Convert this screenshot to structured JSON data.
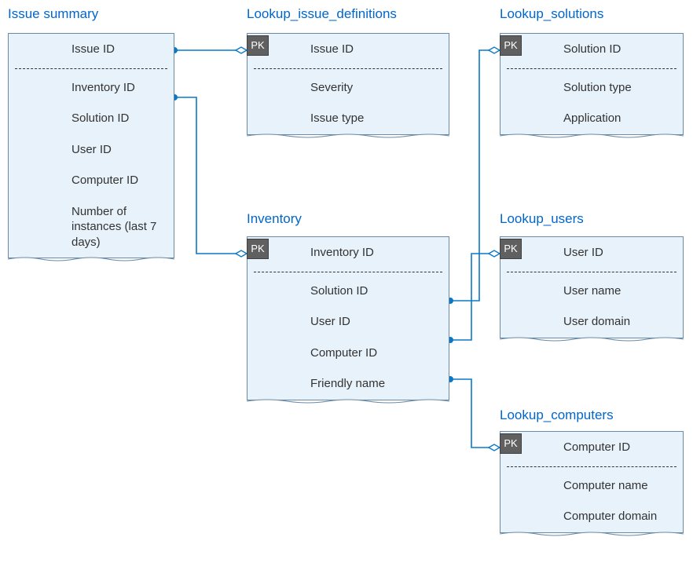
{
  "issue_summary": {
    "title": "Issue summary",
    "row0": "Issue ID",
    "row1": "Inventory ID",
    "row2": "Solution ID",
    "row3": "User ID",
    "row4": "Computer ID",
    "row5": "Number of instances (last 7 days)"
  },
  "lookup_issue_definitions": {
    "title": "Lookup_issue_definitions",
    "pk": "PK",
    "row0": "Issue ID",
    "row1": "Severity",
    "row2": "Issue type"
  },
  "lookup_solutions": {
    "title": "Lookup_solutions",
    "pk": "PK",
    "row0": "Solution ID",
    "row1": "Solution type",
    "row2": "Application"
  },
  "inventory": {
    "title": "Inventory",
    "pk": "PK",
    "row0": "Inventory ID",
    "row1": "Solution ID",
    "row2": "User ID",
    "row3": "Computer ID",
    "row4": "Friendly name"
  },
  "lookup_users": {
    "title": "Lookup_users",
    "pk": "PK",
    "row0": "User ID",
    "row1": "User name",
    "row2": "User domain"
  },
  "lookup_computers": {
    "title": "Lookup_computers",
    "pk": "PK",
    "row0": "Computer ID",
    "row1": "Computer name",
    "row2": "Computer domain"
  },
  "chart_data": {
    "type": "erd",
    "entities": [
      {
        "name": "Issue summary",
        "attributes": [
          "Issue ID",
          "Inventory ID",
          "Solution ID",
          "User ID",
          "Computer ID",
          "Number of instances (last 7 days)"
        ],
        "pk": []
      },
      {
        "name": "Lookup_issue_definitions",
        "attributes": [
          "Issue ID",
          "Severity",
          "Issue type"
        ],
        "pk": [
          "Issue ID"
        ]
      },
      {
        "name": "Lookup_solutions",
        "attributes": [
          "Solution ID",
          "Solution type",
          "Application"
        ],
        "pk": [
          "Solution ID"
        ]
      },
      {
        "name": "Inventory",
        "attributes": [
          "Inventory ID",
          "Solution ID",
          "User ID",
          "Computer ID",
          "Friendly name"
        ],
        "pk": [
          "Inventory ID"
        ]
      },
      {
        "name": "Lookup_users",
        "attributes": [
          "User ID",
          "User name",
          "User domain"
        ],
        "pk": [
          "User ID"
        ]
      },
      {
        "name": "Lookup_computers",
        "attributes": [
          "Computer ID",
          "Computer name",
          "Computer domain"
        ],
        "pk": [
          "Computer ID"
        ]
      }
    ],
    "relationships": [
      {
        "from": "Issue summary.Issue ID",
        "to": "Lookup_issue_definitions.Issue ID"
      },
      {
        "from": "Issue summary.Inventory ID",
        "to": "Inventory.Inventory ID"
      },
      {
        "from": "Inventory.Solution ID",
        "to": "Lookup_solutions.Solution ID"
      },
      {
        "from": "Inventory.User ID",
        "to": "Lookup_users.User ID"
      },
      {
        "from": "Inventory.Computer ID",
        "to": "Lookup_computers.Computer ID"
      }
    ]
  }
}
